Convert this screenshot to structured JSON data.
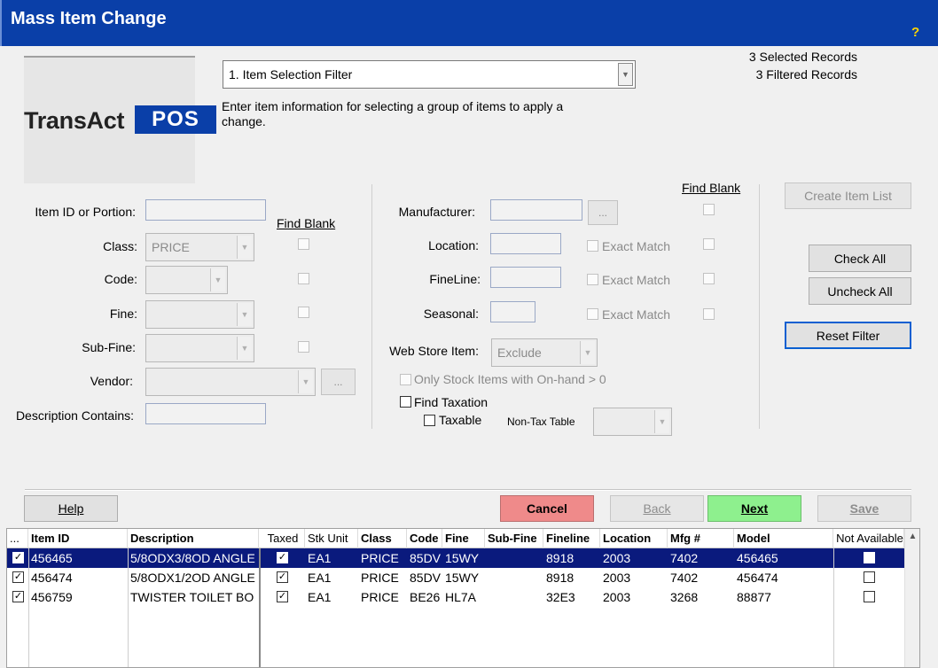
{
  "window": {
    "title": "Mass Item Change",
    "help_glyph": "?"
  },
  "logo": {
    "brand": "TransAct",
    "brand_suffix": "POS"
  },
  "step_select": {
    "value": "1. Item Selection Filter"
  },
  "instructions": "Enter item information for selecting a group of items to apply a change.",
  "counts": {
    "selected": "3 Selected Records",
    "filtered": "3 Filtered Records"
  },
  "filter_left": {
    "find_blank_label": "Find Blank",
    "item_id_label": "Item ID or Portion:",
    "item_id_value": "",
    "class_label": "Class:",
    "class_value": "PRICE",
    "code_label": "Code:",
    "fine_label": "Fine:",
    "subfine_label": "Sub-Fine:",
    "vendor_label": "Vendor:",
    "vendor_button": "...",
    "description_label": "Description Contains:",
    "description_value": ""
  },
  "filter_mid": {
    "find_blank_label": "Find Blank",
    "manufacturer_label": "Manufacturer:",
    "manufacturer_button": "...",
    "location_label": "Location:",
    "fineline_label": "FineLine:",
    "seasonal_label": "Seasonal:",
    "exact_match_label": "Exact Match",
    "webstore_label": "Web Store Item:",
    "webstore_value": "Exclude",
    "only_stock_label": "Only Stock Items with On-hand > 0",
    "find_taxation_label": "Find Taxation",
    "taxable_label": "Taxable",
    "nontax_label": "Non-Tax Table"
  },
  "right_buttons": {
    "create_item_list": "Create Item List",
    "check_all": "Check All",
    "uncheck_all": "Uncheck All",
    "reset_filter": "Reset Filter"
  },
  "bottom_buttons": {
    "help": "Help",
    "cancel": "Cancel",
    "back": "Back",
    "next": "Next",
    "save": "Save"
  },
  "grid": {
    "columns": [
      "...",
      "Item ID",
      "Description",
      "Taxed",
      "Stk Unit",
      "Class",
      "Code",
      "Fine",
      "Sub-Fine",
      "Fineline",
      "Location",
      "Mfg #",
      "Model",
      "Not Available"
    ],
    "rows": [
      {
        "checked": true,
        "item_id": "456465",
        "description": "5/8ODX3/8OD ANGLE",
        "taxed": true,
        "stk_unit": "EA1",
        "class": "PRICE",
        "code": "85DV",
        "fine": "15WY",
        "sub_fine": "",
        "fineline": "8918",
        "location": "2003",
        "mfg": "7402",
        "model": "456465",
        "not_available": false
      },
      {
        "checked": true,
        "item_id": "456474",
        "description": "5/8ODX1/2OD ANGLE",
        "taxed": true,
        "stk_unit": "EA1",
        "class": "PRICE",
        "code": "85DV",
        "fine": "15WY",
        "sub_fine": "",
        "fineline": "8918",
        "location": "2003",
        "mfg": "7402",
        "model": "456474",
        "not_available": false
      },
      {
        "checked": true,
        "item_id": "456759",
        "description": "TWISTER TOILET BO",
        "taxed": true,
        "stk_unit": "EA1",
        "class": "PRICE",
        "code": "BE26",
        "fine": "HL7A",
        "sub_fine": "",
        "fineline": "32E3",
        "location": "2003",
        "mfg": "3268",
        "model": "88877",
        "not_available": false
      }
    ]
  },
  "colors": {
    "title_bar": "#0a3fa8",
    "selected_row": "#0a1a7d",
    "cancel_button": "#ef8a8a",
    "next_button": "#8ef08e"
  }
}
